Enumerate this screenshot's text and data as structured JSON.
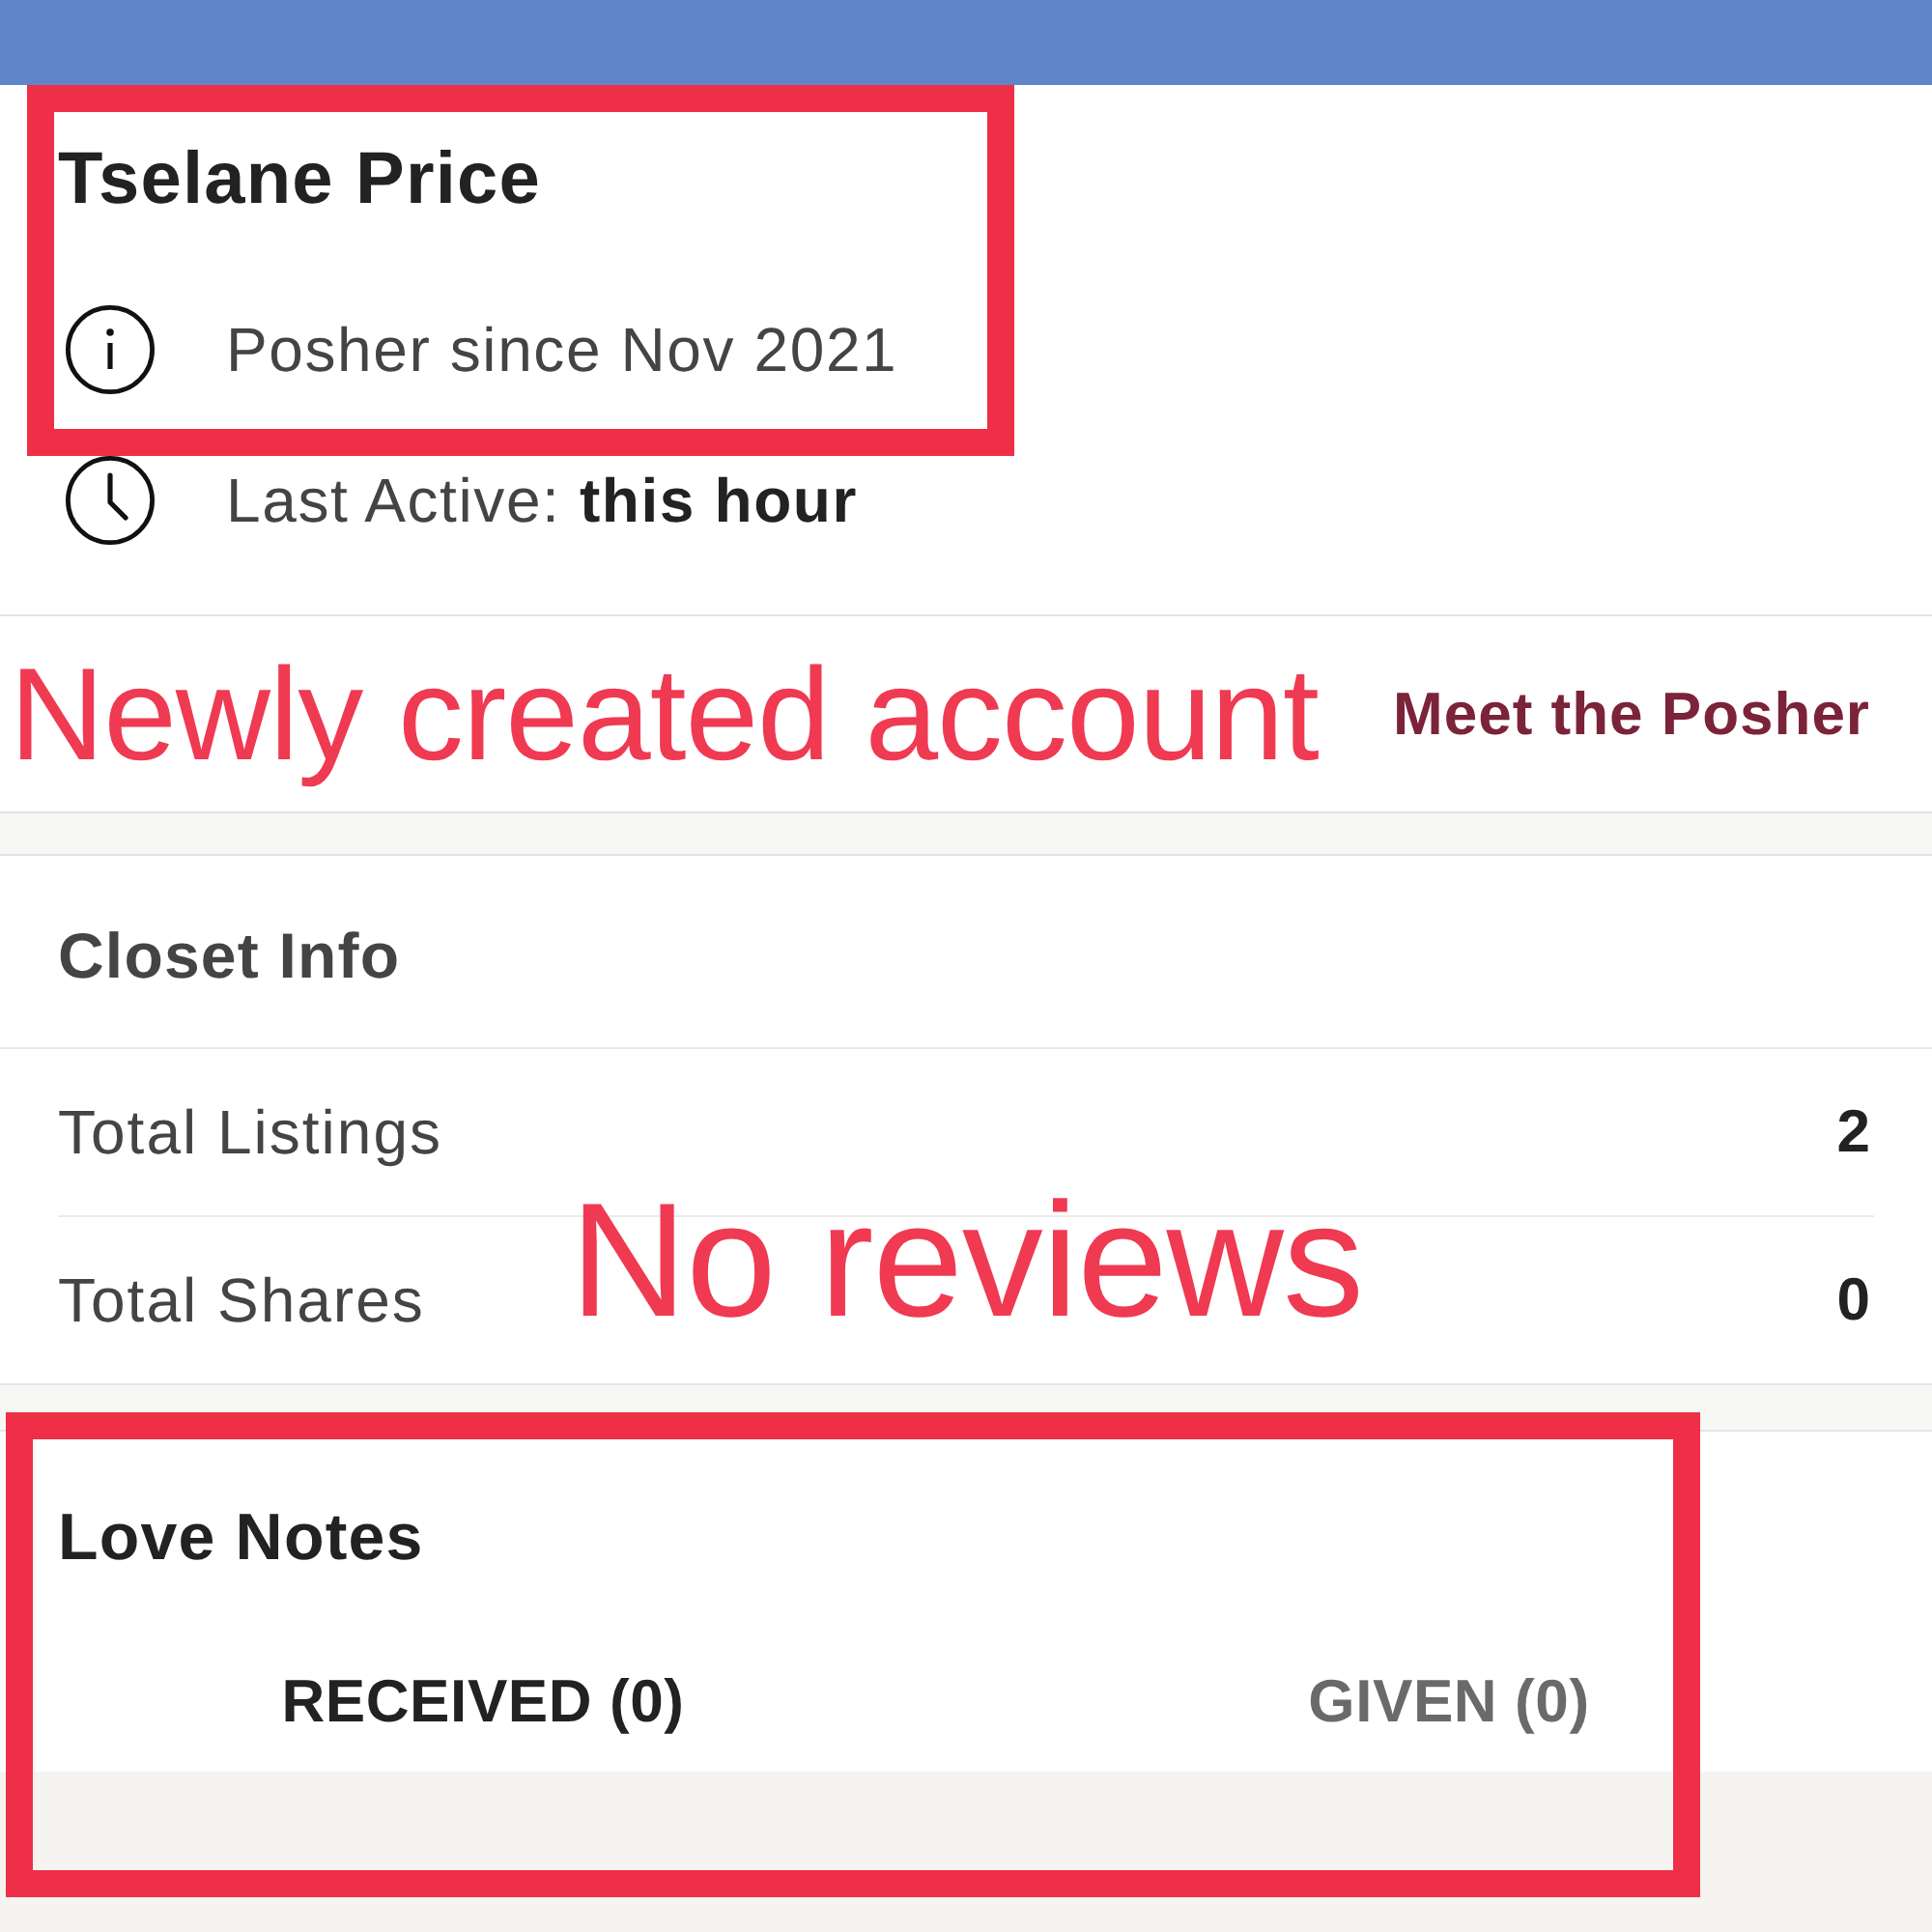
{
  "profile": {
    "name": "Tselane Price",
    "highlighted": true,
    "details": [
      {
        "kind": "info",
        "text": "Posher since Nov 2021",
        "highlighted": true
      },
      {
        "kind": "clock",
        "text": "Last Active: **this hour**",
        "highlighted": false
      }
    ]
  },
  "meet_the_posher": {
    "annotation": "Newly created account",
    "link": "Meet the Posher"
  },
  "closet_info": {
    "title": "Closet Info",
    "annotation": "No reviews",
    "rows": [
      {
        "label": "Total Listings",
        "value": "2"
      },
      {
        "label": "Total Shares",
        "value": "0"
      }
    ]
  },
  "love_notes": {
    "title": "Love Notes",
    "highlighted": true,
    "tabs": [
      {
        "label": "RECEIVED (0)",
        "selected": true
      },
      {
        "label": "GIVEN (0)",
        "selected": false
      }
    ]
  }
}
